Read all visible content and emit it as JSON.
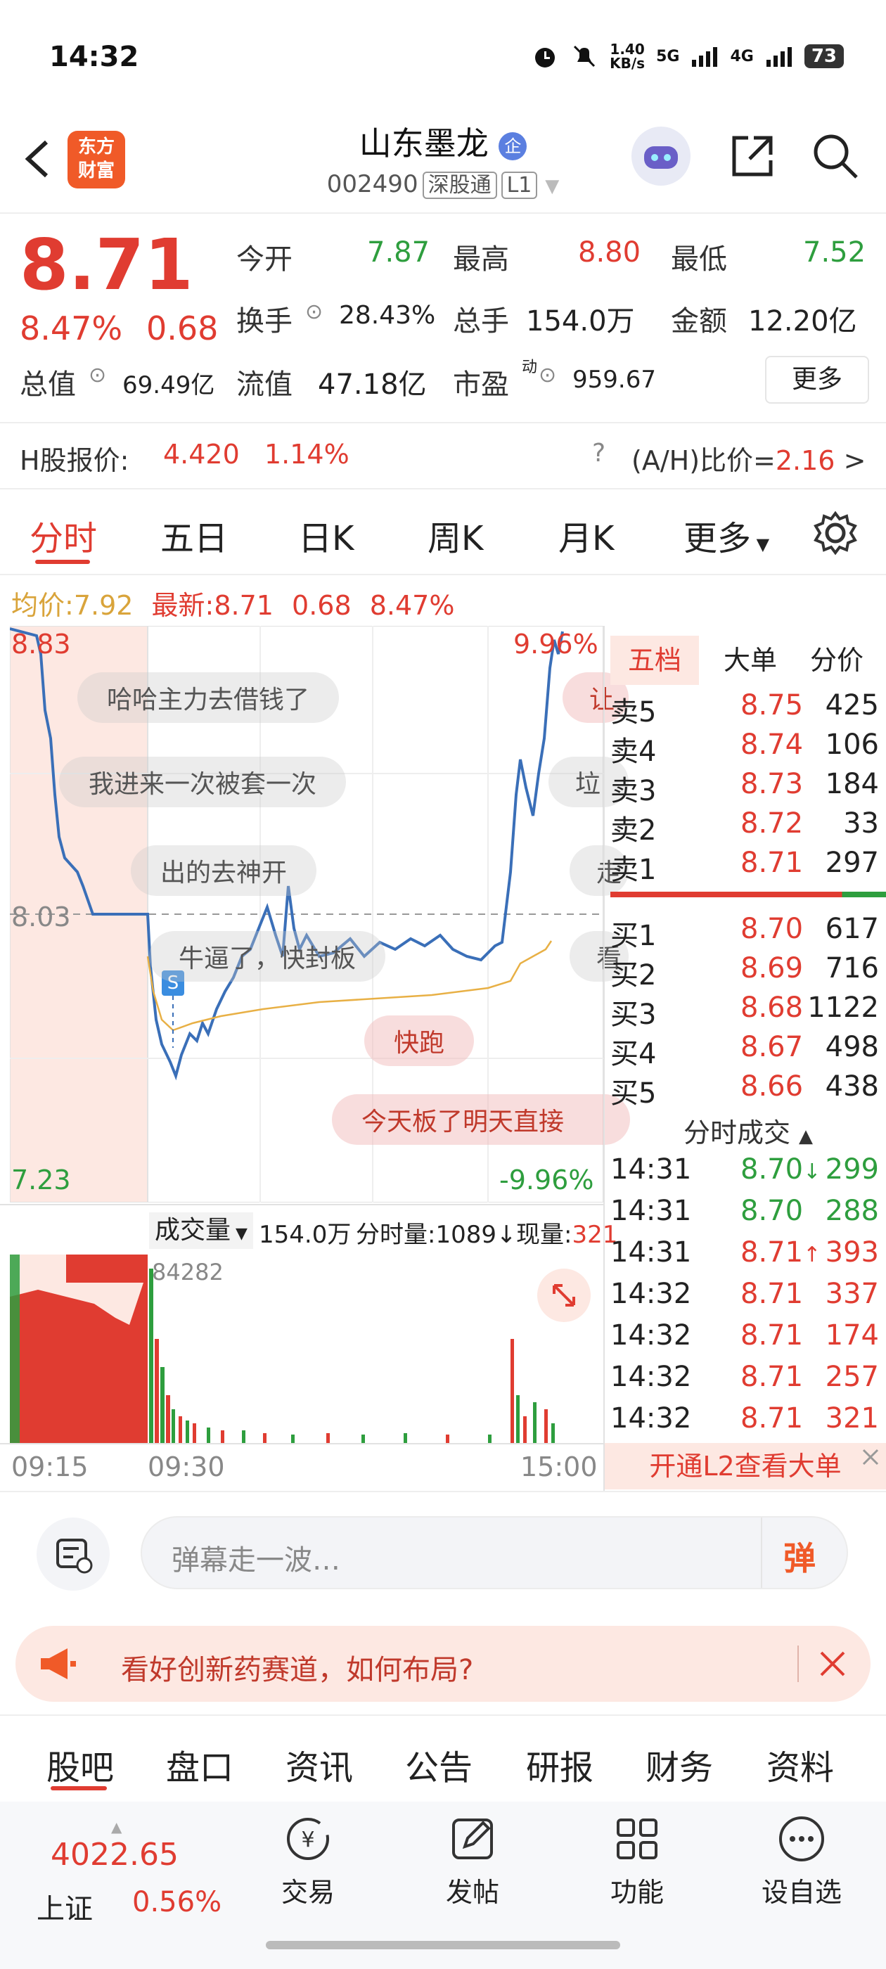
{
  "status": {
    "time": "14:32",
    "net_speed": "1.40\nKB/s",
    "net1": "5G",
    "net2": "4G",
    "battery": "73"
  },
  "header": {
    "logo_text": "东方\n财富",
    "title": "山东墨龙",
    "code": "002490",
    "tag1": "深股通",
    "tag2": "L1",
    "enterprise_badge": "企"
  },
  "quote": {
    "price": "8.71",
    "pct": "8.47%",
    "change": "0.68",
    "open_label": "今开",
    "open": "7.87",
    "high_label": "最高",
    "high": "8.80",
    "low_label": "最低",
    "low": "7.52",
    "turnover_label": "换手",
    "turnover": "28.43%",
    "volume_label": "总手",
    "volume": "154.0万",
    "amount_label": "金额",
    "amount": "12.20亿",
    "mktcap_label": "总值",
    "mktcap": "69.49亿",
    "float_label": "流值",
    "float": "47.18亿",
    "pe_label": "市盈",
    "pe_sup": "动",
    "pe": "959.67",
    "more": "更多"
  },
  "hshare": {
    "label": "H股报价:",
    "price": "4.420",
    "pct": "1.14%",
    "ah_label": "(A/H)比价=",
    "ah_value": "2.16",
    "arrow": ">"
  },
  "chart_tabs": [
    "分时",
    "五日",
    "日K",
    "周K",
    "月K",
    "更多"
  ],
  "info_line": {
    "avg_label": "均价:",
    "avg": "7.92",
    "latest_label": "最新:",
    "latest": "8.71",
    "chg": "0.68",
    "pct": "8.47%"
  },
  "chart": {
    "y_top": "8.83",
    "y_mid": "8.03",
    "y_bot": "7.23",
    "pct_top": "9.96%",
    "pct_bot": "-9.96%"
  },
  "danmu": [
    "哈哈主力去借钱了",
    "我进来一次被套一次",
    "出的去神开",
    "牛逼了，快封板",
    "快跑",
    "今天板了明天直接",
    "让",
    "垃",
    "走",
    "看"
  ],
  "s_badge": "S",
  "vol_bar": {
    "label": "成交量",
    "total": "154.0万",
    "fen_label": "分时量:1089",
    "now_label": "现量:",
    "now": "321",
    "max": "84282"
  },
  "x_axis": {
    "t1": "09:15",
    "t2": "09:30",
    "t3": "15:00"
  },
  "book_tabs": [
    "五档",
    "大单",
    "分价"
  ],
  "asks": [
    {
      "label": "卖5",
      "price": "8.75",
      "vol": "425"
    },
    {
      "label": "卖4",
      "price": "8.74",
      "vol": "106"
    },
    {
      "label": "卖3",
      "price": "8.73",
      "vol": "184"
    },
    {
      "label": "卖2",
      "price": "8.72",
      "vol": "33"
    },
    {
      "label": "卖1",
      "price": "8.71",
      "vol": "297"
    }
  ],
  "bids": [
    {
      "label": "买1",
      "price": "8.70",
      "vol": "617"
    },
    {
      "label": "买2",
      "price": "8.69",
      "vol": "716"
    },
    {
      "label": "买3",
      "price": "8.68",
      "vol": "1122"
    },
    {
      "label": "买4",
      "price": "8.67",
      "vol": "498"
    },
    {
      "label": "买5",
      "price": "8.66",
      "vol": "438"
    }
  ],
  "ticks_title": "分时成交",
  "ticks": [
    {
      "time": "14:31",
      "price": "8.70",
      "dir": "↓",
      "vol": "299",
      "color": "#2e9e3e"
    },
    {
      "time": "14:31",
      "price": "8.70",
      "dir": "",
      "vol": "288",
      "color": "#2e9e3e"
    },
    {
      "time": "14:31",
      "price": "8.71",
      "dir": "↑",
      "vol": "393",
      "color": "#e03c31"
    },
    {
      "time": "14:32",
      "price": "8.71",
      "dir": "",
      "vol": "337",
      "color": "#e03c31"
    },
    {
      "time": "14:32",
      "price": "8.71",
      "dir": "",
      "vol": "174",
      "color": "#e03c31"
    },
    {
      "time": "14:32",
      "price": "8.71",
      "dir": "",
      "vol": "257",
      "color": "#e03c31"
    },
    {
      "time": "14:32",
      "price": "8.71",
      "dir": "",
      "vol": "321",
      "color": "#e03c31"
    }
  ],
  "l2_banner": "开通L2查看大单",
  "danmu_input": {
    "placeholder": "弹幕走一波…",
    "send": "弹"
  },
  "promo": {
    "text": "看好创新药赛道，如何布局?"
  },
  "bottom_tabs": [
    "股吧",
    "盘口",
    "资讯",
    "公告",
    "研报",
    "财务",
    "资料"
  ],
  "index": {
    "value": "4022.65",
    "name": "上证",
    "pct": "0.56%"
  },
  "nav": [
    "交易",
    "发帖",
    "功能",
    "设自选"
  ],
  "colors": {
    "red": "#e03c31",
    "green": "#2e9e3e",
    "line": "#3a6fb8",
    "avg": "#e8b045",
    "accent": "#f05a28"
  }
}
